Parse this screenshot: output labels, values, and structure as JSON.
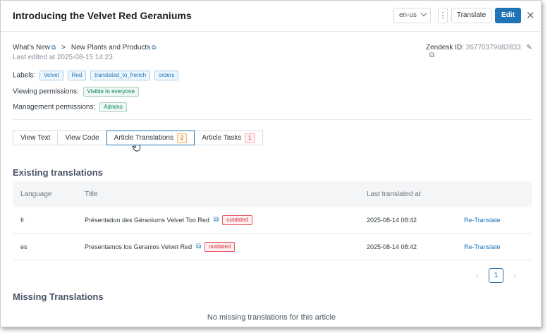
{
  "header": {
    "title": "Introducing the Velvet Red Geraniums",
    "locale": "en-us",
    "kebab": "⋮",
    "translate_label": "Translate",
    "edit_label": "Edit",
    "close": "✕"
  },
  "breadcrumb": {
    "item1": "What's New",
    "item2": "New Plants and Products",
    "separator": ">"
  },
  "last_edited": "Last edited at 2025-08-15 14:23",
  "zendesk": {
    "label": "Zendesk ID:",
    "id": "26770379682833"
  },
  "labels": {
    "label": "Labels:",
    "tags": [
      "Velvet",
      "Red",
      "translated_to_french",
      "orders"
    ]
  },
  "viewing": {
    "label": "Viewing permissions:",
    "value": "Visible to everyone"
  },
  "management": {
    "label": "Management permissions:",
    "value": "Admins"
  },
  "tabs": [
    {
      "label": "View Text"
    },
    {
      "label": "View Code"
    },
    {
      "label": "Article Translations",
      "count": "2"
    },
    {
      "label": "Article Tasks",
      "count": "1"
    }
  ],
  "existing": {
    "title": "Existing translations",
    "columns": {
      "language": "Language",
      "title": "Title",
      "last_translated": "Last translated at"
    },
    "rows": [
      {
        "lang": "fr",
        "title": "Présentation des Géraniums Velvet Too Red",
        "status": "outdated",
        "date": "2025-08-14 08:42",
        "action": "Re-Translate"
      },
      {
        "lang": "es",
        "title": "Presentamos los Geranios Velvet Red",
        "status": "outdated",
        "date": "2025-08-14 08:42",
        "action": "Re-Translate"
      }
    ]
  },
  "pagination": {
    "prev": "‹",
    "current": "1",
    "next": "›"
  },
  "missing": {
    "title": "Missing Translations",
    "empty_text": "No missing translations for this article"
  },
  "colors": {
    "accent": "#1f73b7",
    "outdated": "#cc3340"
  }
}
